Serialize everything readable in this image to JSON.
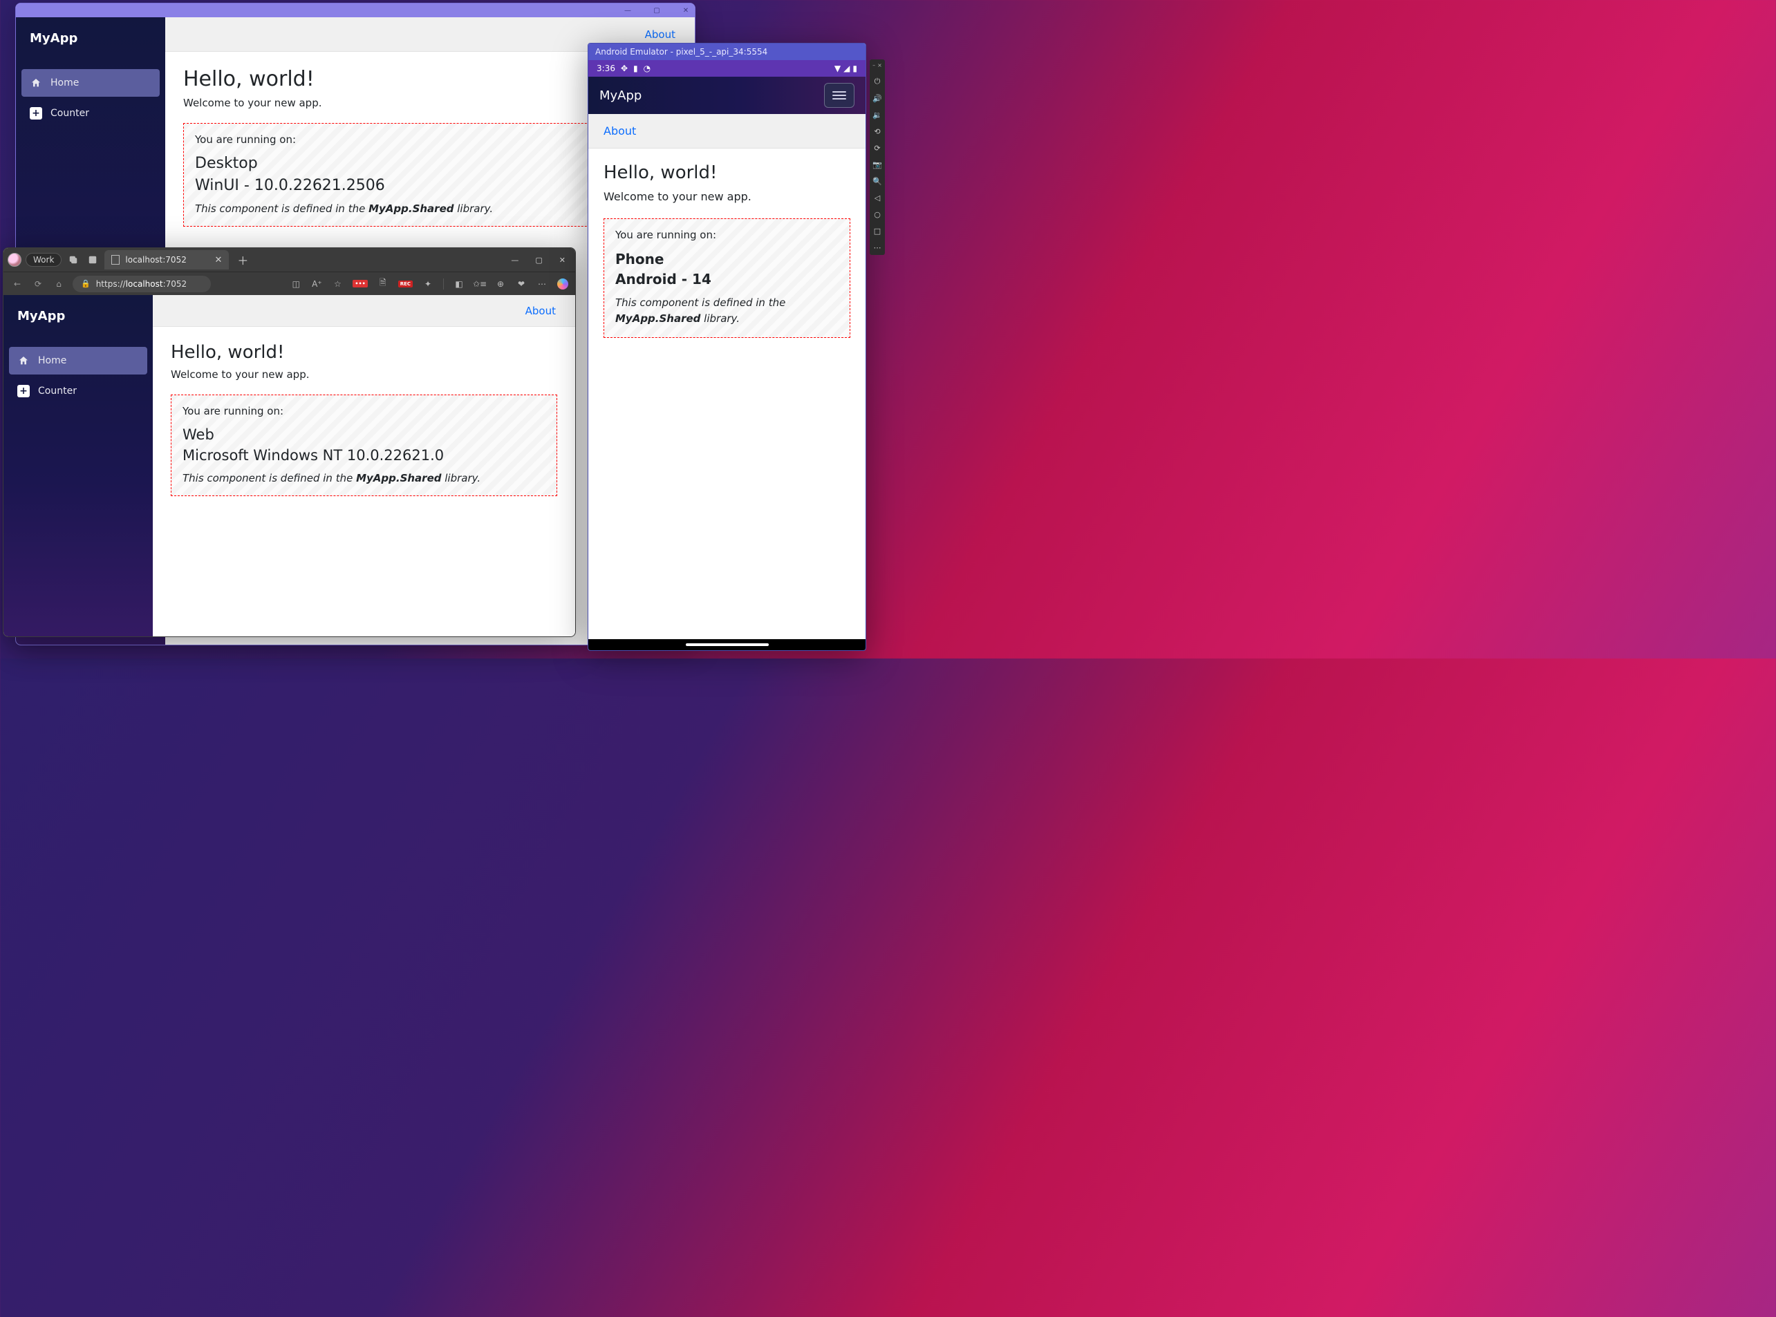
{
  "desktop": {
    "brand": "MyApp",
    "nav": {
      "home": "Home",
      "counter": "Counter"
    },
    "about": "About",
    "heading": "Hello, world!",
    "welcome": "Welcome to your new app.",
    "box": {
      "label": "You are running on:",
      "line1": "Desktop",
      "line2": "WinUI - 10.0.22621.2506",
      "note_pre": "This component is defined in the ",
      "note_lib": "MyApp.Shared",
      "note_post": " library."
    },
    "win_controls": {
      "min": "—",
      "max": "▢",
      "close": "✕"
    }
  },
  "web": {
    "browser": {
      "work_label": "Work",
      "tab_title": "localhost:7052",
      "url_display_prefix": "https://",
      "url_display_host": "localhost",
      "url_display_suffix": ":7052",
      "ext_red": "•••",
      "ext_rec": "REC"
    },
    "brand": "MyApp",
    "nav": {
      "home": "Home",
      "counter": "Counter"
    },
    "about": "About",
    "heading": "Hello, world!",
    "welcome": "Welcome to your new app.",
    "box": {
      "label": "You are running on:",
      "line1": "Web",
      "line2": "Microsoft Windows NT 10.0.22621.0",
      "note_pre": "This component is defined in the ",
      "note_lib": "MyApp.Shared",
      "note_post": " library."
    }
  },
  "android": {
    "emu_title": "Android Emulator - pixel_5_-_api_34:5554",
    "status_time": "3:36",
    "brand": "MyApp",
    "about": "About",
    "heading": "Hello, world!",
    "welcome": "Welcome to your new app.",
    "box": {
      "label": "You are running on:",
      "line1": "Phone",
      "line2": "Android - 14",
      "note_pre": "This component is defined in the ",
      "note_lib": "MyApp.Shared",
      "note_post": " library."
    }
  }
}
